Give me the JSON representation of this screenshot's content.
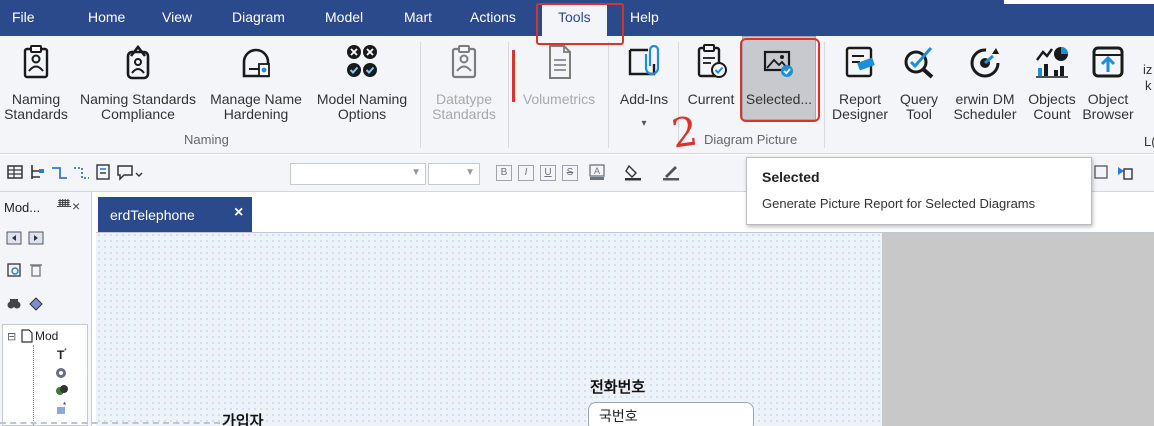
{
  "menu": {
    "items": [
      "File",
      "Home",
      "View",
      "Diagram",
      "Model",
      "Mart",
      "Actions",
      "Tools",
      "Help"
    ],
    "active": "Tools"
  },
  "ribbon": {
    "naming_standards": "Naming\nStandards",
    "naming_standards_compliance": "Naming Standards\nCompliance",
    "manage_name_hardening": "Manage Name\nHardening",
    "model_naming_options": "Model Naming\nOptions",
    "naming_group": "Naming",
    "datatype_standards": "Datatype\nStandards",
    "volumetrics": "Volumetrics",
    "add_ins": "Add-Ins",
    "add_ins_dropdown": "▾",
    "current": "Current",
    "selected": "Selected...",
    "diagram_picture_group": "Diagram Picture",
    "report_designer": "Report\nDesigner",
    "query_tool": "Query\nTool",
    "erwin_dm_scheduler": "erwin DM\nScheduler",
    "objects_count": "Objects\nCount",
    "object_browser": "Object\nBrowser",
    "cut_text_1": "iz",
    "cut_text_2": "k",
    "cut_text_3": "L("
  },
  "annotation": {
    "handwritten_number": "2"
  },
  "tooltip": {
    "title": "Selected",
    "description": "Generate Picture Report for Selected Diagrams"
  },
  "model_panel": {
    "title": "Mod...",
    "pin": "ᚙ",
    "close": "×",
    "tree_root": "Mod"
  },
  "tab": {
    "label": "erdTelephone",
    "close": "×"
  },
  "diagram": {
    "entity1_title": "전화번호",
    "entity1_attr": "국번호",
    "entity2_title": "가입자"
  },
  "colors": {
    "menubar": "#2b4a8c",
    "ribbon": "#f4f5f8",
    "annotation": "#d9342b",
    "canvas": "#eef3fa"
  }
}
